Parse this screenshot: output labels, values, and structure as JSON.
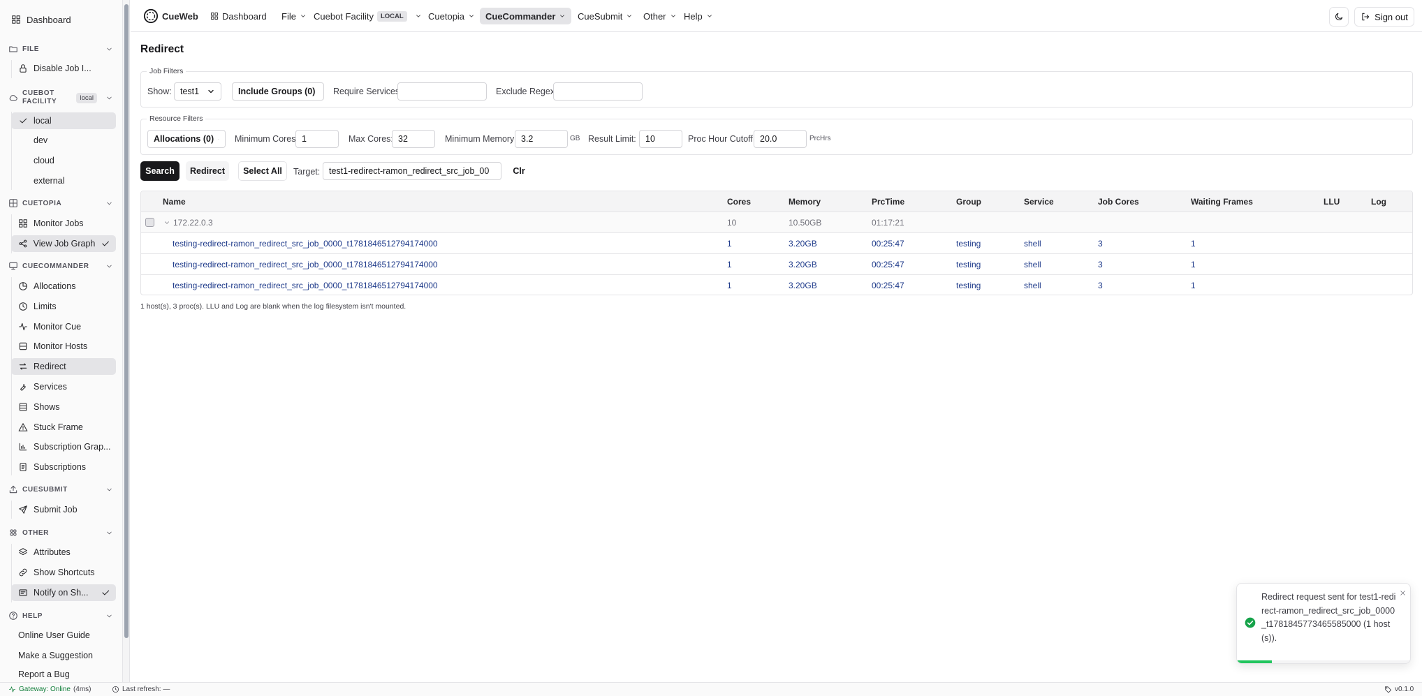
{
  "sidebar": {
    "dashboard": "Dashboard",
    "sections": {
      "file": {
        "title": "FILE",
        "items": [
          "Disable Job I..."
        ]
      },
      "cuebot": {
        "title": "CUEBOT FACILITY",
        "badge": "local",
        "items": [
          "local",
          "dev",
          "cloud",
          "external"
        ],
        "selected": "local"
      },
      "cuetopia": {
        "title": "CUETOPIA",
        "items": [
          "Monitor Jobs",
          "View Job Graph"
        ]
      },
      "cuecommander": {
        "title": "CUECOMMANDER",
        "items": [
          "Allocations",
          "Limits",
          "Monitor Cue",
          "Monitor Hosts",
          "Redirect",
          "Services",
          "Shows",
          "Stuck Frame",
          "Subscription Grap...",
          "Subscriptions"
        ],
        "active": "Redirect"
      },
      "cuesubmit": {
        "title": "CUESUBMIT",
        "items": [
          "Submit Job"
        ]
      },
      "other": {
        "title": "OTHER",
        "items": [
          "Attributes",
          "Show Shortcuts",
          "Notify on Sh..."
        ]
      },
      "help": {
        "title": "HELP",
        "items": [
          "Online User Guide",
          "Make a Suggestion",
          "Report a Bug"
        ]
      }
    }
  },
  "topnav": {
    "brand": "CueWeb",
    "items": {
      "dashboard": "Dashboard",
      "file": "File",
      "cuebot": "Cuebot Facility",
      "cuebot_tag": "LOCAL",
      "cuetopia": "Cuetopia",
      "cuecommander": "CueCommander",
      "cuesubmit": "CueSubmit",
      "other": "Other",
      "help": "Help"
    },
    "sign_out": "Sign out"
  },
  "page": {
    "title": "Redirect",
    "job_filters": {
      "legend": "Job Filters",
      "show_label": "Show:",
      "show_value": "test1",
      "include_groups": "Include Groups (0)",
      "require_services_label": "Require Services",
      "require_services_value": "",
      "exclude_regex_label": "Exclude Regex",
      "exclude_regex_value": ""
    },
    "resource_filters": {
      "legend": "Resource Filters",
      "allocations": "Allocations (0)",
      "min_cores_label": "Minimum Cores:",
      "min_cores_value": "1",
      "max_cores_label": "Max Cores:",
      "max_cores_value": "32",
      "min_memory_label": "Minimum Memory:",
      "min_memory_value": "3.2",
      "min_memory_unit": "GB",
      "result_limit_label": "Result Limit:",
      "result_limit_value": "10",
      "proc_hour_label": "Proc Hour Cutoff:",
      "proc_hour_value": "20.0",
      "proc_hour_unit": "PrcHrs"
    },
    "actions": {
      "search": "Search",
      "redirect": "Redirect",
      "select_all": "Select All",
      "target_label": "Target:",
      "target_value": "test1-redirect-ramon_redirect_src_job_00",
      "clear": "Clr"
    },
    "table": {
      "headers": [
        "Name",
        "Cores",
        "Memory",
        "PrcTime",
        "Group",
        "Service",
        "Job Cores",
        "Waiting Frames",
        "LLU",
        "Log"
      ],
      "group_row": {
        "name": "172.22.0.3",
        "cores": "10",
        "memory": "10.50GB",
        "prctime": "01:17:21"
      },
      "rows": [
        {
          "name": "testing-redirect-ramon_redirect_src_job_0000_t1781846512794174000",
          "cores": "1",
          "memory": "3.20GB",
          "prctime": "00:25:47",
          "group": "testing",
          "service": "shell",
          "job_cores": "3",
          "waiting": "1",
          "llu": "",
          "log": ""
        },
        {
          "name": "testing-redirect-ramon_redirect_src_job_0000_t1781846512794174000",
          "cores": "1",
          "memory": "3.20GB",
          "prctime": "00:25:47",
          "group": "testing",
          "service": "shell",
          "job_cores": "3",
          "waiting": "1",
          "llu": "",
          "log": ""
        },
        {
          "name": "testing-redirect-ramon_redirect_src_job_0000_t1781846512794174000",
          "cores": "1",
          "memory": "3.20GB",
          "prctime": "00:25:47",
          "group": "testing",
          "service": "shell",
          "job_cores": "3",
          "waiting": "1",
          "llu": "",
          "log": ""
        }
      ]
    },
    "footer_note": "1 host(s), 3 proc(s). LLU and Log are blank when the log filesystem isn't mounted."
  },
  "statusbar": {
    "gateway": "Gateway: Online",
    "latency": "(4ms)",
    "last_refresh": "Last refresh: —",
    "version": "v0.1.0"
  },
  "toast": {
    "message": "Redirect request sent for test1-redirect-ramon_redirect_src_job_0000_t1781845773465585000 (1 host(s)).",
    "progress": 0.2
  },
  "colors": {
    "accent": "#18181b",
    "link": "#1e3a8a",
    "success": "#22c55e",
    "active_bg": "#e4e4e7"
  }
}
